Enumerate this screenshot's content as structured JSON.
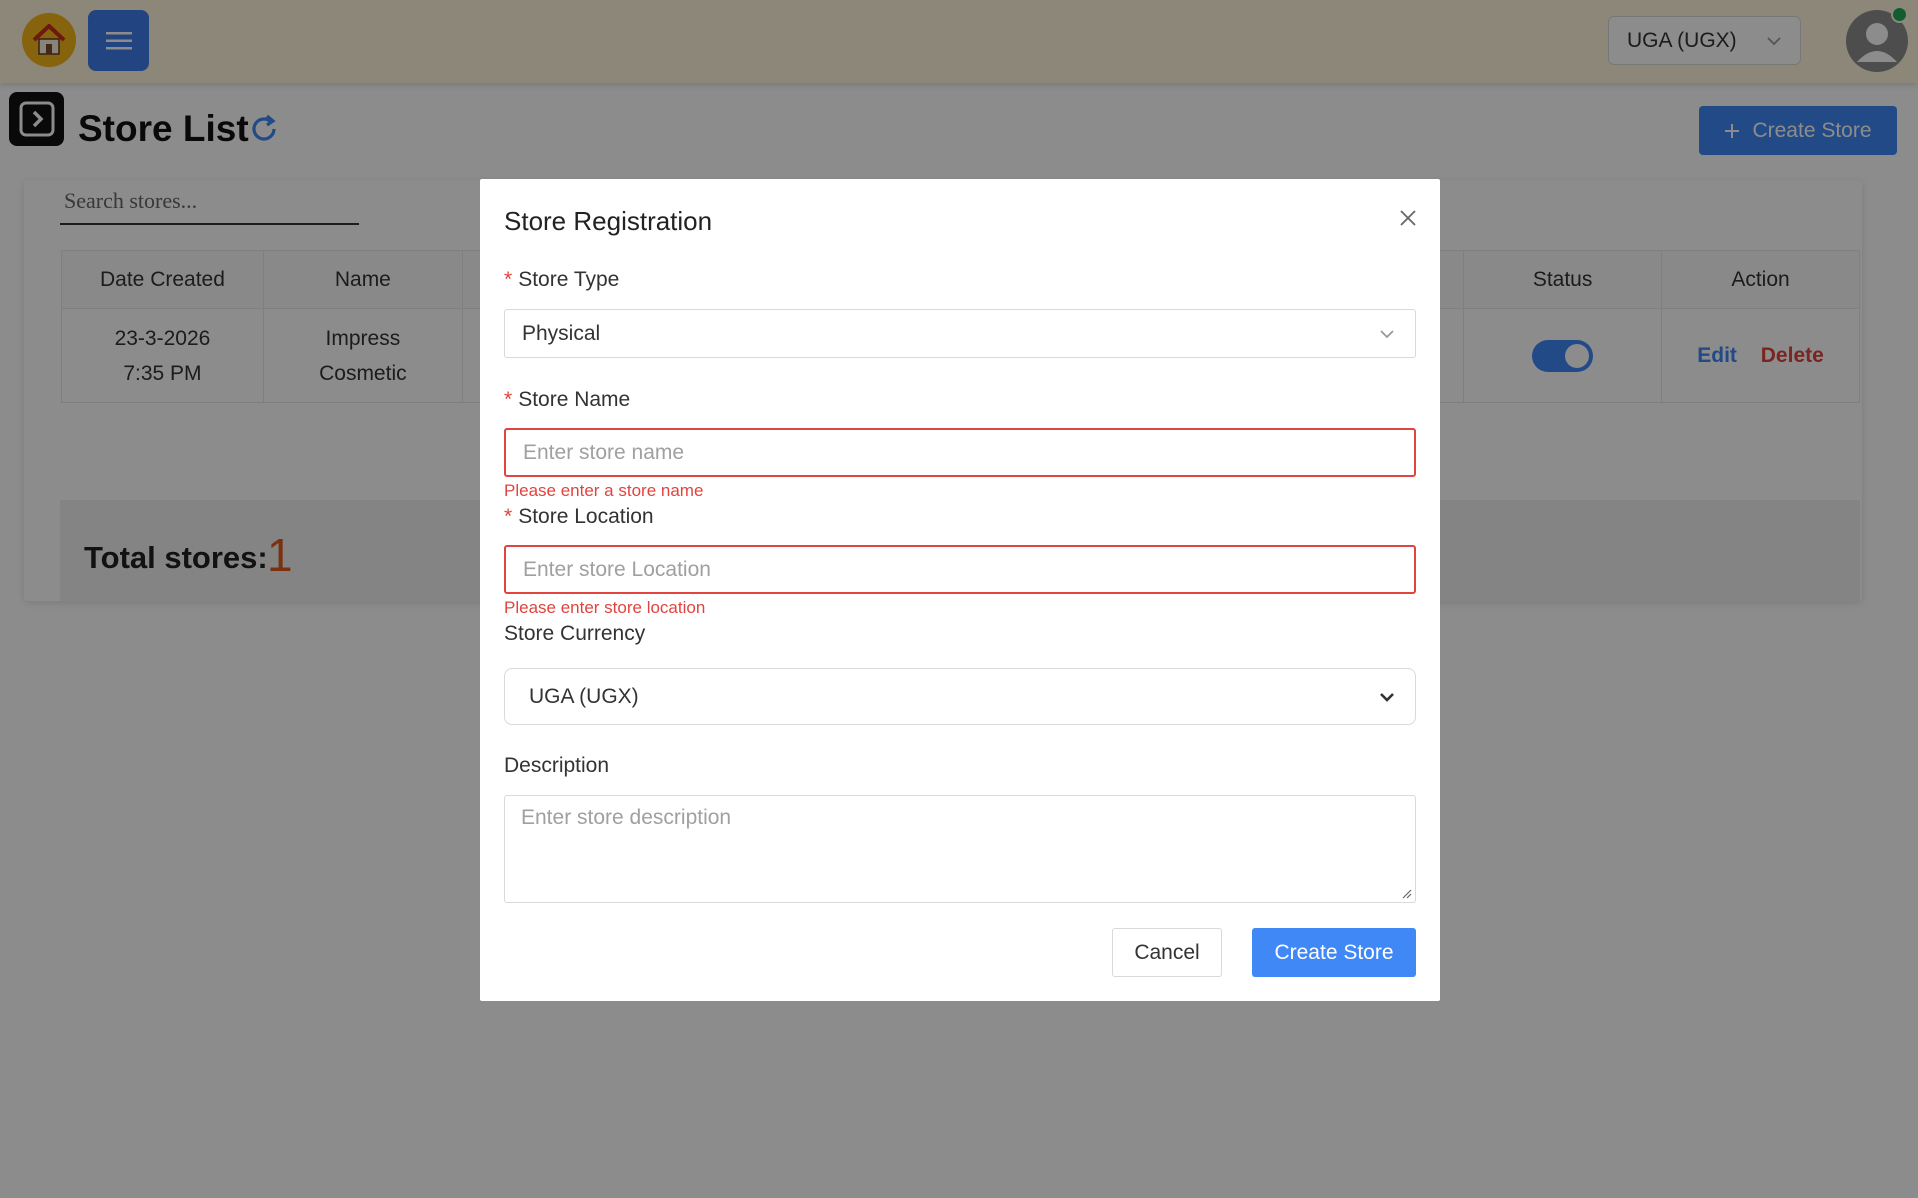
{
  "header": {
    "currency": "UGA (UGX)"
  },
  "page": {
    "title": "Store List",
    "create_button": "Create Store",
    "search_placeholder": "Search stores..."
  },
  "table": {
    "columns": [
      "Date Created",
      "Name",
      "Status",
      "Action"
    ],
    "rows": [
      {
        "date": "23-3-2026",
        "time": "7:35 PM",
        "name_line1": "Impress",
        "name_line2": "Cosmetic",
        "status_on": true,
        "edit": "Edit",
        "delete": "Delete"
      }
    ]
  },
  "summary": {
    "label": "Total stores:",
    "value": "1"
  },
  "modal": {
    "title": "Store Registration",
    "store_type": {
      "label": "Store Type",
      "required_mark": "*",
      "value": "Physical"
    },
    "store_name": {
      "label": "Store Name",
      "required_mark": "*",
      "placeholder": "Enter store name",
      "error": "Please enter a store name"
    },
    "store_location": {
      "label": "Store Location",
      "required_mark": "*",
      "placeholder": "Enter store Location",
      "error": "Please enter store location"
    },
    "store_currency": {
      "label": "Store Currency",
      "value": "UGA (UGX)"
    },
    "description": {
      "label": "Description",
      "placeholder": "Enter store description"
    },
    "cancel_button": "Cancel",
    "submit_button": "Create Store"
  },
  "colors": {
    "primary": "#3f88f5",
    "danger": "#e0443f",
    "accent_orange": "#e05a1c",
    "home_yellow": "#f5b619",
    "online_green": "#1faa59"
  },
  "icons": [
    "home-icon",
    "menu-icon",
    "chevron-down-icon",
    "user-icon",
    "panel-expand-icon",
    "refresh-icon",
    "plus-icon",
    "close-icon"
  ]
}
